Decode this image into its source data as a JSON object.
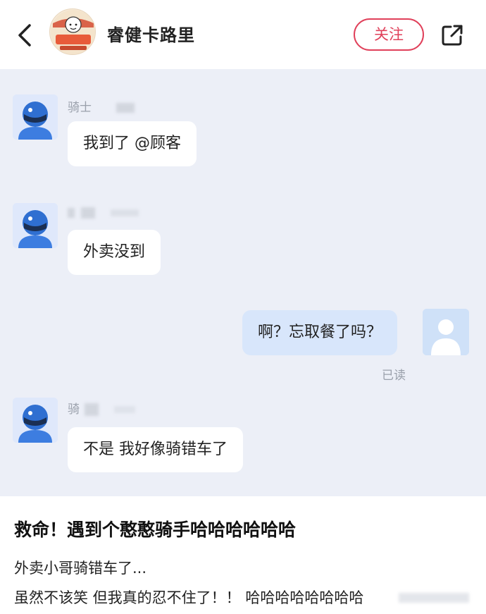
{
  "header": {
    "shop_name": "睿健卡路里",
    "follow_label": "关注",
    "logo_text": "睿健卡路里"
  },
  "chat": {
    "messages": [
      {
        "sender": "骑士",
        "text": "我到了 @顾客"
      },
      {
        "sender": "骑",
        "text": "外卖没到"
      },
      {
        "sender": "me",
        "text": "啊？忘取餐了吗？",
        "status": "已读"
      },
      {
        "sender": "骑",
        "text": "不是 我好像骑错车了"
      }
    ]
  },
  "post": {
    "title": "救命！遇到个憨憨骑手哈哈哈哈哈哈",
    "line1": "外卖小哥骑错车了...",
    "line2": "虽然不该笑 但我真的忍不住了！！ 哈哈哈哈哈哈哈哈"
  },
  "colors": {
    "accent": "#e0405a",
    "chat_bg": "#eceff7",
    "my_bubble": "#d8e6fb",
    "rider_avatar": "#2f6fd1"
  }
}
